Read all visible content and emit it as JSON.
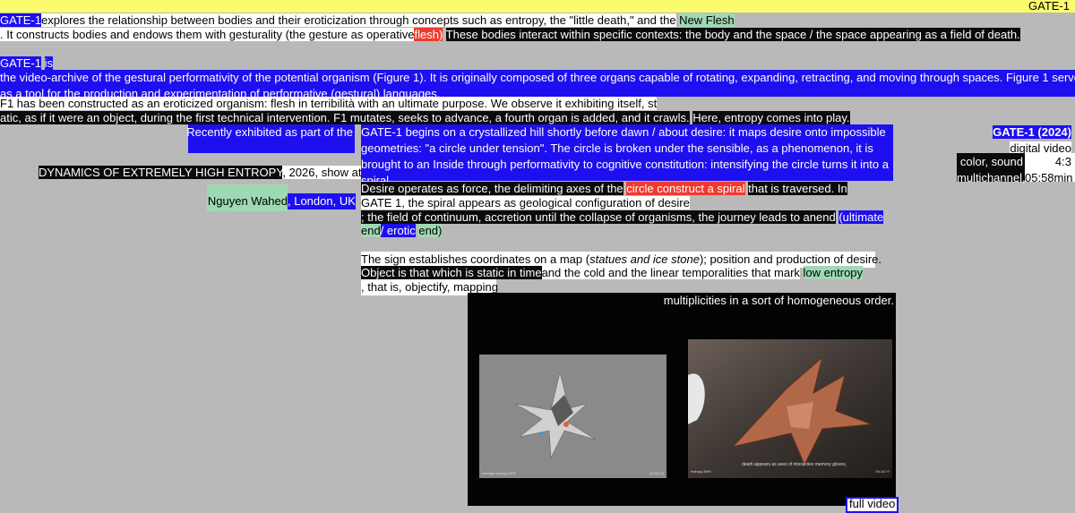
{
  "header": {
    "label": "GATE-1"
  },
  "intro": {
    "line1": {
      "tag": "GATE-1",
      "text": "explores the relationship between bodies and their eroticization through concepts such as entropy, the \"little death,\" and the",
      "new_flesh": "New Flesh"
    },
    "line2": {
      "text": ". It constructs bodies and endows them with gesturality (the gesture as operative",
      "flesh": "flesh)",
      "tail": "These bodies interact within specific contexts: the body and the space / the space appearing as a field of death."
    }
  },
  "archive": {
    "tag": "GATE-1",
    "is": "is",
    "line1": "the video-archive of the gestural performativity of the potential organism (Figure 1). It is originally composed of three organs capable of rotating, expanding, retracting, and moving through spaces. Figure 1 serves",
    "line2": "as a tool for the production and experimentation of performative (gestural) languages.",
    "f1_line1": "F1 has been constructed as an eroticized organism: flesh in terribilità with an ultimate purpose. We observe it exhibiting itself, st",
    "f1_line2": "atic, as if it were an object, during the first technical intervention. F1 mutates, seeks to advance, a fourth organ is added, and it crawls.",
    "f1_line2_tail": "Here, entropy comes into play."
  },
  "exhibit": {
    "recent": "Recently exhibited as part of the",
    "show": "DYNAMICS OF EXTREMELY HIGH ENTROPY",
    "show_tail": ", 2026, show at",
    "gallery": "Nguyen Wahed",
    "city": ", London, UK"
  },
  "body": {
    "p1": [
      "GATE-1 begins on a crystallized hill shortly before dawn / about desire: it maps desire onto impossible",
      "geometries: \"a circle under tension\". The circle is broken under the sensible, as a phenomenon, it is",
      "brought to an Inside through performativity to cognitive constitution: intensifying the circle turns it into a",
      "spiral."
    ],
    "p2": {
      "a": "Desire operates as force, the delimiting axes of the",
      "spiral": "circle construct a spiral",
      "b": "that is traversed. In",
      "c": "GATE 1, the spiral appears as geological configuration of desire",
      "d": "; the field of continuum, accretion until the collapse of organisms, the journey leads to an",
      "end": "end",
      "ultimate": "(ultimate",
      "end2": "end",
      "erotic": "/ erotic",
      "end3": "end)"
    },
    "p3": {
      "a": "The sign establishes coordinates on a map (",
      "italic": "statues and ice stone",
      "b": "); position and production of desire.",
      "obj": "Object is that which is static in time",
      "c": "and the cold and the linear temporalities that mark",
      "low": "low entropy",
      "d": ", that is, objectify, mapping",
      "e": "multiplicities in a sort of homogeneous order."
    }
  },
  "meta": {
    "title": "GATE-1 (2024)",
    "medium": "digital video",
    "ratio": "4:3",
    "color": "color, sound",
    "multi": "multichannel,",
    "duration": "05:58min"
  },
  "videos": {
    "v1_caption": "average entropy 59%",
    "v1_time": "00:02:34",
    "v2_caption": "entropy 59%",
    "v2_sub": "death appears as axes of interactive memory gloves,",
    "v2_time": "00:14:??",
    "full": "full video"
  }
}
